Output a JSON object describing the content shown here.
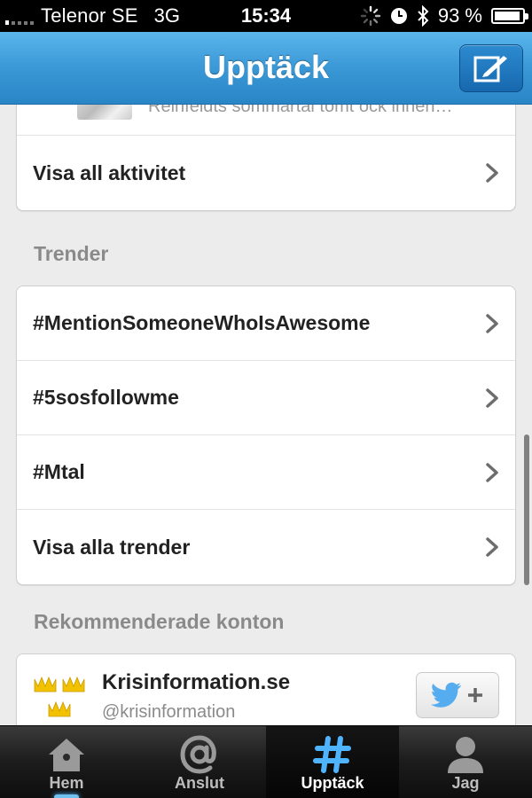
{
  "status_bar": {
    "carrier": "Telenor SE",
    "network": "3G",
    "time": "15:34",
    "battery": "93 %",
    "battery_level": 0.93
  },
  "nav": {
    "title": "Upptäck",
    "compose_icon": "compose-icon"
  },
  "activity": {
    "snippet": "Reinfeldts sommartal tomt ock inneh…",
    "show_all_label": "Visa all aktivitet"
  },
  "trends": {
    "section_title": "Trender",
    "items": [
      {
        "label": "#MentionSomeoneWhoIsAwesome"
      },
      {
        "label": "#5sosfollowme"
      },
      {
        "label": "#Mtal"
      }
    ],
    "show_all_label": "Visa alla trender"
  },
  "recommended": {
    "section_title": "Rekommenderade konton",
    "accounts": [
      {
        "name": "Krisinformation.se",
        "handle": "@krisinformation",
        "follow_icon": "twitter-follow-icon"
      }
    ]
  },
  "tab_bar": {
    "tabs": [
      {
        "label": "Hem",
        "icon": "home-icon",
        "active": false
      },
      {
        "label": "Anslut",
        "icon": "at-icon",
        "active": false
      },
      {
        "label": "Upptäck",
        "icon": "hashtag-icon",
        "active": true
      },
      {
        "label": "Jag",
        "icon": "person-icon",
        "active": false
      }
    ]
  },
  "colors": {
    "nav_blue": "#3b99d7",
    "active_tab_icon": "#4fb4ff",
    "twitter_blue": "#55acee",
    "crown_gold": "#f2c200"
  }
}
